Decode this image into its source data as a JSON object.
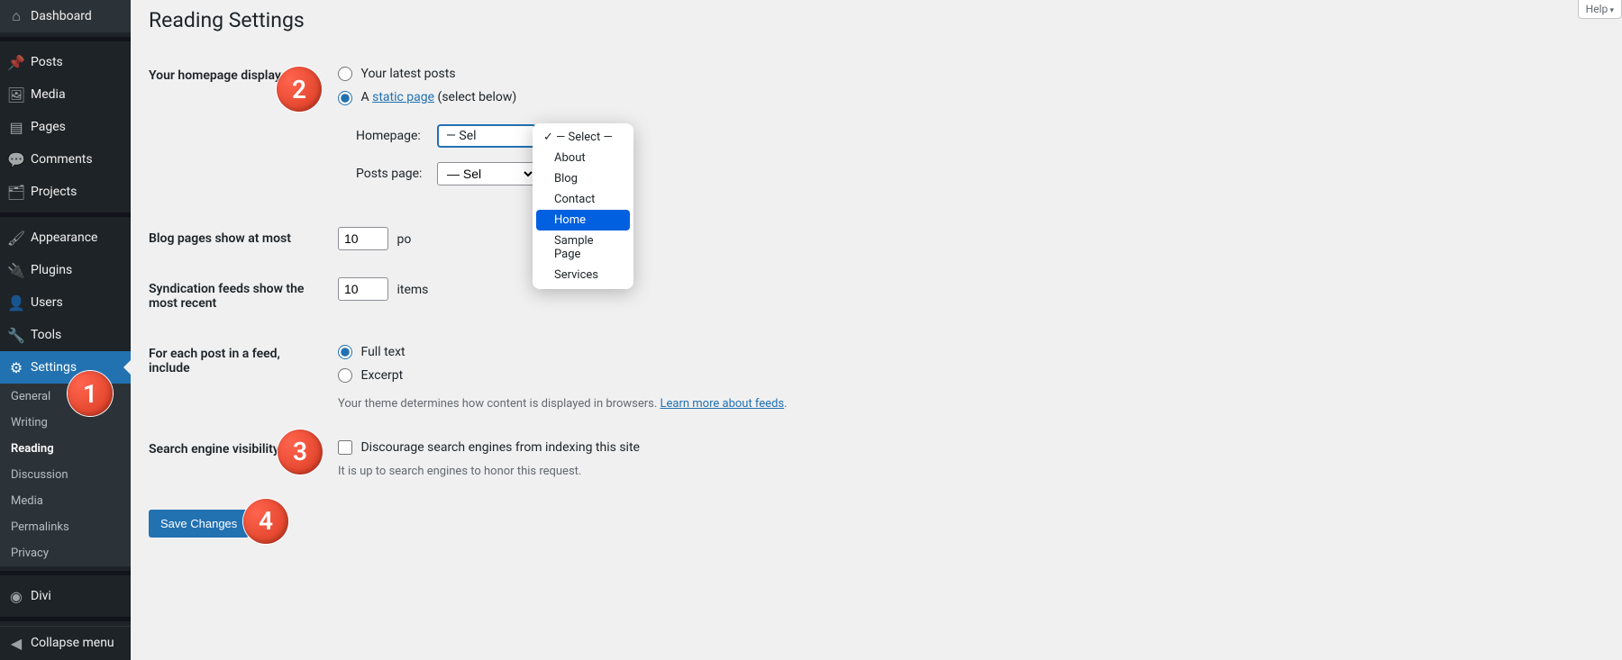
{
  "help": "Help",
  "sidebar": {
    "items": [
      {
        "label": "Dashboard",
        "icon": "⌂"
      },
      {
        "label": "Posts",
        "icon": "📌"
      },
      {
        "label": "Media",
        "icon": "🖼"
      },
      {
        "label": "Pages",
        "icon": "▤"
      },
      {
        "label": "Comments",
        "icon": "💬"
      },
      {
        "label": "Projects",
        "icon": "🗂"
      },
      {
        "label": "Appearance",
        "icon": "🖌"
      },
      {
        "label": "Plugins",
        "icon": "🔌"
      },
      {
        "label": "Users",
        "icon": "👤"
      },
      {
        "label": "Tools",
        "icon": "🔧"
      },
      {
        "label": "Settings",
        "icon": "⚙"
      },
      {
        "label": "Divi",
        "icon": "◉"
      }
    ],
    "submenu": [
      "General",
      "Writing",
      "Reading",
      "Discussion",
      "Media",
      "Permalinks",
      "Privacy"
    ],
    "collapse": "Collapse menu"
  },
  "page": {
    "title": "Reading Settings",
    "homepage_th": "Your homepage displays",
    "radio_latest": "Your latest posts",
    "radio_static_prefix": "A ",
    "radio_static_link": "static page",
    "radio_static_suffix": " (select below)",
    "homepage_lbl": "Homepage:",
    "posts_page_lbl": "Posts page:",
    "posts_select_placeholder": "— Sel",
    "blog_pages_th": "Blog pages show at most",
    "blog_pages_val": "10",
    "blog_pages_unit": "po",
    "syndication_th": "Syndication feeds show the most recent",
    "syndication_val": "10",
    "syndication_unit": "items",
    "feed_th": "For each post in a feed, include",
    "feed_full": "Full text",
    "feed_excerpt": "Excerpt",
    "feed_desc_prefix": "Your theme determines how content is displayed in browsers. ",
    "feed_desc_link": "Learn more about feeds",
    "feed_desc_suffix": ".",
    "search_th": "Search engine visibility",
    "search_cb": "Discourage search engines from indexing this site",
    "search_desc": "It is up to search engines to honor this request.",
    "save": "Save Changes"
  },
  "dropdown": {
    "options": [
      "— Select —",
      "About",
      "Blog",
      "Contact",
      "Home",
      "Sample Page",
      "Services"
    ],
    "selected": 0,
    "highlighted": 4
  },
  "badges": [
    "1",
    "2",
    "3",
    "4"
  ]
}
